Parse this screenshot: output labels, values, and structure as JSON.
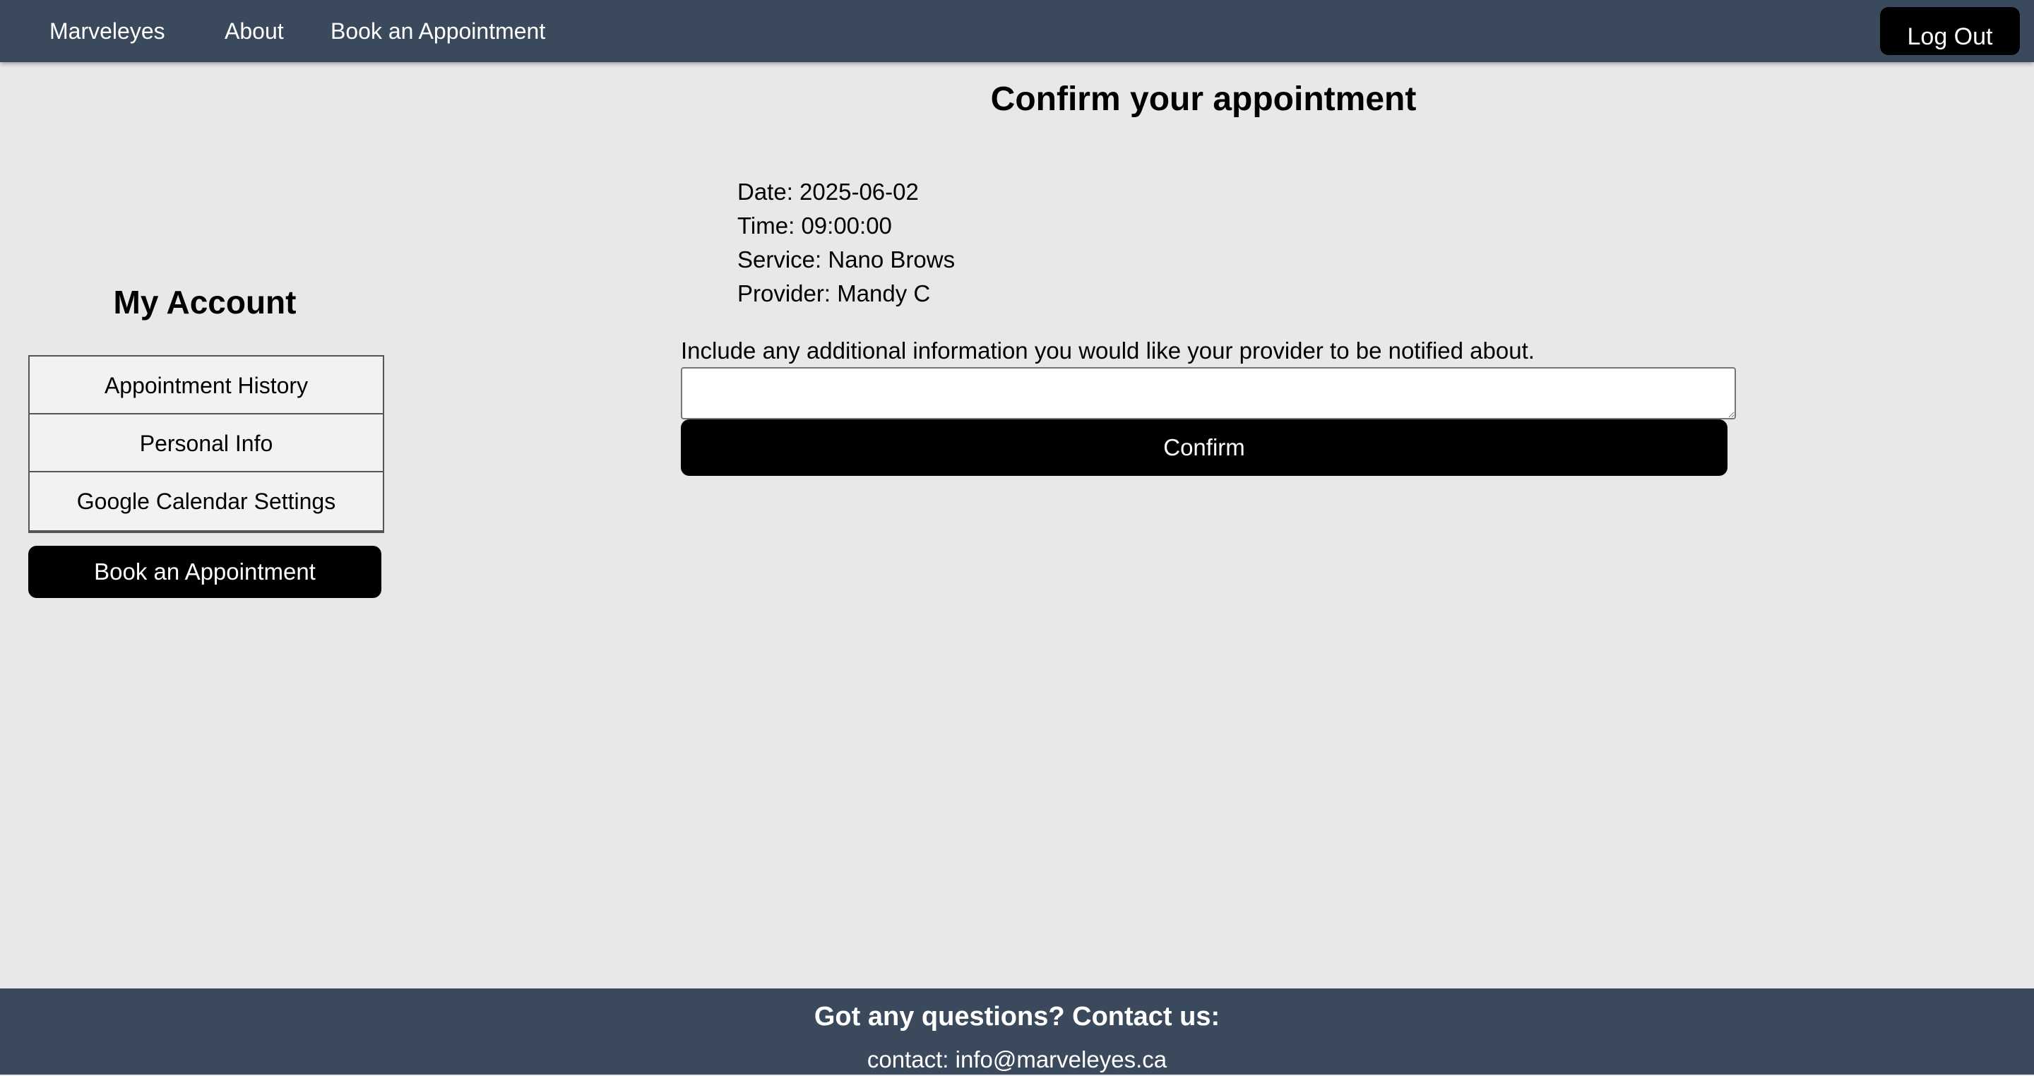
{
  "nav": {
    "brand": "Marveleyes",
    "about": "About",
    "book": "Book an Appointment",
    "logout": "Log Out"
  },
  "sidebar": {
    "title": "My Account",
    "items": [
      {
        "label": "Appointment History"
      },
      {
        "label": "Personal Info"
      },
      {
        "label": "Google Calendar Settings"
      }
    ],
    "book_button": "Book an Appointment"
  },
  "main": {
    "title": "Confirm your appointment",
    "details": {
      "date": "Date: 2025-06-02",
      "time": "Time: 09:00:00",
      "service": "Service: Nano Brows",
      "provider": "Provider: Mandy C"
    },
    "notes_label": "Include any additional information you would like your provider to be notified about.",
    "notes_value": "",
    "confirm_button": "Confirm"
  },
  "footer": {
    "heading": "Got any questions? Contact us:",
    "contact": "contact: info@marveleyes.ca"
  },
  "colors": {
    "header_bg": "#3a4a5c",
    "page_bg": "#e8e8e8",
    "button_bg": "#000000",
    "button_text": "#ffffff",
    "menu_bg": "#f2f2f2"
  }
}
